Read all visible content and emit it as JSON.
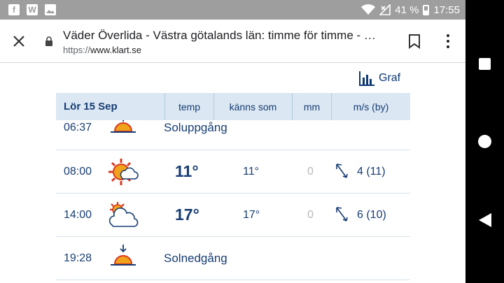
{
  "status_bar": {
    "left_icons": [
      "facebook-icon",
      "wattpad-icon",
      "gallery-icon"
    ],
    "facebook_glyph": "f",
    "wattpad_glyph": "W",
    "battery": "41 %",
    "time": "17:55"
  },
  "browser": {
    "title": "Väder Överlida - Västra götalands län: timme för timme - …",
    "url_scheme": "https://",
    "url_domain": "www.klart.se"
  },
  "graf_link": "Graf",
  "table": {
    "date": "Lör 15 Sep",
    "columns": [
      "temp",
      "känns som",
      "mm",
      "m/s (by)"
    ]
  },
  "rows": [
    {
      "time": "06:37",
      "icon": "sunrise-icon",
      "label": "Soluppgång"
    },
    {
      "time": "08:00",
      "icon": "sun-cloud-icon",
      "temp": "11°",
      "feels": "11°",
      "mm": "0",
      "wind": "4 (11)"
    },
    {
      "time": "14:00",
      "icon": "cloud-sun-icon",
      "temp": "17°",
      "feels": "17°",
      "mm": "0",
      "wind": "6 (10)"
    },
    {
      "time": "19:28",
      "icon": "sunset-icon",
      "label": "Solnedgång"
    }
  ],
  "colors": {
    "brand_navy": "#173d73",
    "header_bg": "#dbe7f3",
    "status_bar": "#9e9e9e",
    "sun_orange": "#f0a21c",
    "sun_red": "#d9381e"
  }
}
